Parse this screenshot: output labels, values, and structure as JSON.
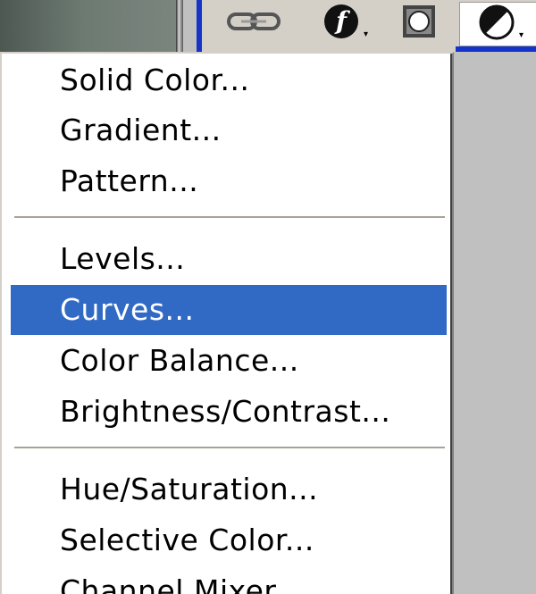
{
  "toolbar": {
    "buttons": [
      {
        "name": "link-layers",
        "icon": "link-icon"
      },
      {
        "name": "add-layer-style",
        "icon": "fx-icon",
        "label": "f"
      },
      {
        "name": "add-layer-mask",
        "icon": "mask-icon"
      },
      {
        "name": "new-fill-adjustment-layer",
        "icon": "half-circle-icon"
      }
    ],
    "accent_color": "#1533c8"
  },
  "menu": {
    "highlight_color": "#316ac5",
    "groups": [
      {
        "items": [
          {
            "label": "Solid Color..."
          },
          {
            "label": "Gradient..."
          },
          {
            "label": "Pattern..."
          }
        ]
      },
      {
        "items": [
          {
            "label": "Levels..."
          },
          {
            "label": "Curves...",
            "highlighted": true
          },
          {
            "label": "Color Balance..."
          },
          {
            "label": "Brightness/Contrast..."
          }
        ]
      },
      {
        "items": [
          {
            "label": "Hue/Saturation..."
          },
          {
            "label": "Selective Color..."
          },
          {
            "label": "Channel Mixer..."
          }
        ]
      }
    ]
  }
}
